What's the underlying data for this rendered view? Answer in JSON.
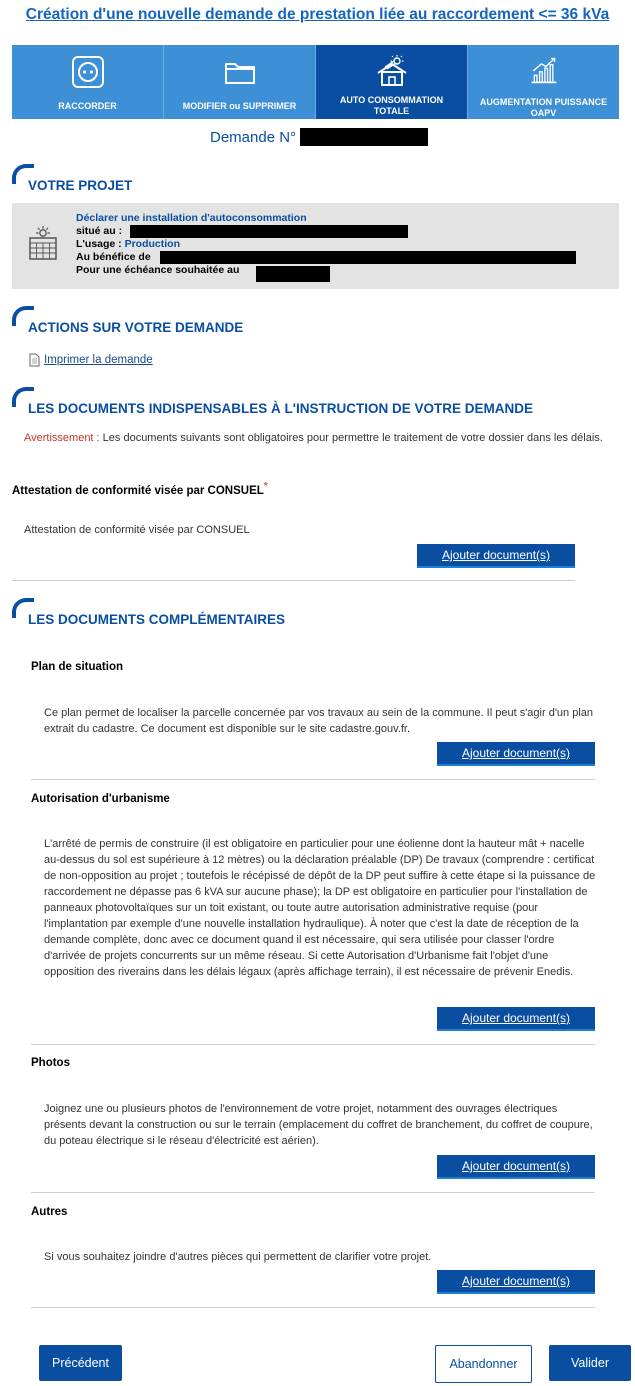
{
  "page_title": "Création d'une nouvelle demande de prestation liée au raccordement <= 36 kVa",
  "tabs": [
    {
      "label": "RACCORDER",
      "icon": "power-outlet-icon",
      "active": false
    },
    {
      "label": "MODIFIER ou SUPPRIMER",
      "icon": "folder-icon",
      "active": false
    },
    {
      "label": "AUTO CONSOMMATION\nTOTALE",
      "icon": "solar-house-icon",
      "active": true
    },
    {
      "label": "AUGMENTATION PUISSANCE\nOAPV",
      "icon": "growth-chart-icon",
      "active": false
    }
  ],
  "demande_label": "Demande N°",
  "project": {
    "title": "VOTRE PROJET",
    "declare": "Déclarer une installation d'autoconsommation",
    "situe_label": "situé au :",
    "usage_label": "L'usage :",
    "usage_value": "Production",
    "benefice_label": "Au bénéfice de",
    "echeance_label": "Pour une échéance souhaitée au"
  },
  "actions": {
    "title": "ACTIONS SUR VOTRE DEMANDE",
    "print_label": "Imprimer la demande"
  },
  "indispensables": {
    "title": "LES DOCUMENTS INDISPENSABLES À L'INSTRUCTION DE VOTRE DEMANDE",
    "warning_label": "Avertissement :",
    "warning_text": " Les documents suivants sont obligatoires pour permettre le traitement de votre dossier dans les délais.",
    "doc_title": "Attestation de conformité visée par CONSUEL",
    "doc_required": "*",
    "doc_desc": "Attestation de conformité visée par CONSUEL",
    "add_label": "Ajouter document(s)"
  },
  "complementaires": {
    "title": "LES DOCUMENTS COMPLÉMENTAIRES",
    "docs": [
      {
        "title": "Plan de situation",
        "desc": "Ce plan permet de localiser la parcelle concernée par vos travaux au sein de la commune. Il peut s'agir d'un plan extrait du cadastre. Ce document est disponible sur le site cadastre.gouv.fr.",
        "add_label": "Ajouter document(s)"
      },
      {
        "title": "Autorisation d'urbanisme",
        "desc": "L'arrêté de permis de construire (il est obligatoire en particulier pour une éolienne dont la hauteur mât + nacelle au-dessus du sol est supérieure à 12 mètres) ou la déclaration préalable (DP) De travaux (comprendre : certificat de non-opposition au projet ; toutefois le récépissé de dépôt de la DP peut suffire à cette étape si la puissance de raccordement ne dépasse pas 6 kVA sur aucune phase); la DP est obligatoire en particulier pour l'installation de panneaux photovoltaïques sur un toit existant, ou toute autre autorisation administrative requise (pour l'implantation par exemple d'une nouvelle installation hydraulique). À noter que c'est la date de réception de la demande complète, donc avec ce document quand il est nécessaire, qui sera utilisée pour classer l'ordre d'arrivée de projets concurrents sur un même réseau. Si cette Autorisation d'Urbanisme fait l'objet d'une opposition des riverains dans les délais légaux (après affichage terrain), il est nécessaire de prévenir Enedis.",
        "add_label": "Ajouter document(s)"
      },
      {
        "title": "Photos",
        "desc": "Joignez une ou plusieurs photos de l'environnement de votre projet, notamment des ouvrages électriques présents devant la construction ou sur le terrain (emplacement du coffret de branchement, du coffret de coupure, du poteau électrique si le réseau d'électricité est aérien).",
        "add_label": "Ajouter document(s)"
      },
      {
        "title": "Autres",
        "desc": "Si vous souhaitez joindre d'autres pièces qui permettent de clarifier votre projet.",
        "add_label": "Ajouter document(s)"
      }
    ]
  },
  "footer": {
    "previous_label": "Précédent",
    "abandon_label": "Abandonner",
    "validate_label": "Valider"
  },
  "colors": {
    "primary": "#0a4ea2",
    "tab_bg": "#3d8fd6",
    "project_bg": "#e3e3e3",
    "warning": "#c0392b"
  }
}
